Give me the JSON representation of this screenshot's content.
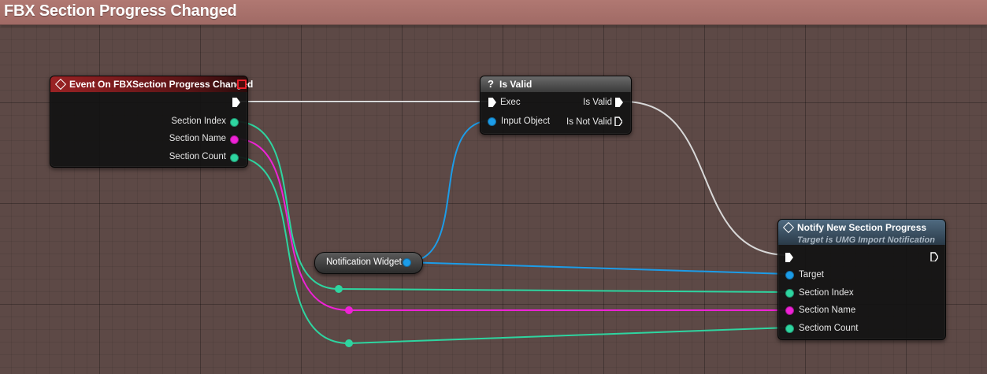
{
  "graph": {
    "title": "FBX Section Progress Changed"
  },
  "nodes": {
    "event": {
      "title": "Event On FBXSection Progress Changed",
      "header_color": "#8a1e20",
      "outputs": [
        "Section Index",
        "Section Name",
        "Section Count"
      ]
    },
    "is_valid": {
      "title": "Is Valid",
      "header_color": "#4e4e4e",
      "inputs": [
        "Exec",
        "Input Object"
      ],
      "outputs": [
        "Is Valid",
        "Is Not Valid"
      ]
    },
    "variable": {
      "title": "Notification Widget"
    },
    "notify": {
      "title": "Notify New Section Progress",
      "subtitle": "Target is UMG Import Notification",
      "header_color": "#4a6478",
      "inputs": [
        "Target",
        "Section Index",
        "Section Name",
        "Sectiom Count"
      ]
    }
  },
  "colors": {
    "exec": "#ffffff",
    "int": "#2ed5a0",
    "name": "#ee22d6",
    "object": "#1c9ce8"
  }
}
